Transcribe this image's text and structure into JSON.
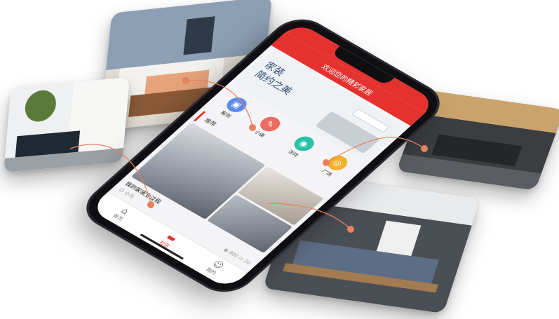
{
  "app": {
    "header_title": "欢迎您的精彩家居",
    "banner": {
      "line1": "家装",
      "line2": "简约之美"
    },
    "icons": [
      {
        "label": "案例",
        "color": "#5b8def",
        "icon": "case-icon",
        "glyph": "▣"
      },
      {
        "label": "小课",
        "color": "#ef6b62",
        "icon": "lesson-icon",
        "glyph": "✎"
      },
      {
        "label": "活动",
        "color": "#27c2a8",
        "icon": "activity-icon",
        "glyph": "◉"
      },
      {
        "label": "广场",
        "color": "#f5b02e",
        "icon": "square-icon",
        "glyph": "◎"
      }
    ],
    "section_title": "推荐",
    "post": {
      "title": "我的家装全过程",
      "author": "小马",
      "views": "800",
      "comments": "20"
    },
    "tabs": [
      {
        "label": "首页",
        "icon": "home-icon",
        "glyph": "⌂",
        "active": false
      },
      {
        "label": "社区",
        "icon": "community-icon",
        "glyph": "▬",
        "active": true
      },
      {
        "label": "我的",
        "icon": "profile-icon",
        "glyph": "☺",
        "active": false
      }
    ]
  },
  "colors": {
    "accent": "#e5322e",
    "link_line": "#e8805f"
  }
}
